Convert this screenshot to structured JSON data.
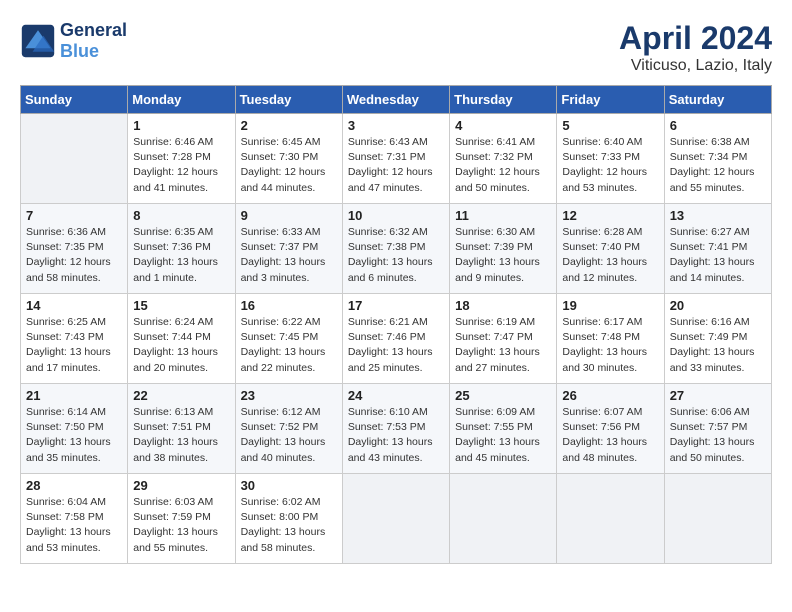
{
  "header": {
    "logo_line1": "General",
    "logo_line2": "Blue",
    "month_title": "April 2024",
    "location": "Viticuso, Lazio, Italy"
  },
  "weekdays": [
    "Sunday",
    "Monday",
    "Tuesday",
    "Wednesday",
    "Thursday",
    "Friday",
    "Saturday"
  ],
  "weeks": [
    [
      {
        "num": "",
        "empty": true
      },
      {
        "num": "1",
        "sunrise": "6:46 AM",
        "sunset": "7:28 PM",
        "daylight": "12 hours and 41 minutes."
      },
      {
        "num": "2",
        "sunrise": "6:45 AM",
        "sunset": "7:30 PM",
        "daylight": "12 hours and 44 minutes."
      },
      {
        "num": "3",
        "sunrise": "6:43 AM",
        "sunset": "7:31 PM",
        "daylight": "12 hours and 47 minutes."
      },
      {
        "num": "4",
        "sunrise": "6:41 AM",
        "sunset": "7:32 PM",
        "daylight": "12 hours and 50 minutes."
      },
      {
        "num": "5",
        "sunrise": "6:40 AM",
        "sunset": "7:33 PM",
        "daylight": "12 hours and 53 minutes."
      },
      {
        "num": "6",
        "sunrise": "6:38 AM",
        "sunset": "7:34 PM",
        "daylight": "12 hours and 55 minutes."
      }
    ],
    [
      {
        "num": "7",
        "sunrise": "6:36 AM",
        "sunset": "7:35 PM",
        "daylight": "12 hours and 58 minutes."
      },
      {
        "num": "8",
        "sunrise": "6:35 AM",
        "sunset": "7:36 PM",
        "daylight": "13 hours and 1 minute."
      },
      {
        "num": "9",
        "sunrise": "6:33 AM",
        "sunset": "7:37 PM",
        "daylight": "13 hours and 3 minutes."
      },
      {
        "num": "10",
        "sunrise": "6:32 AM",
        "sunset": "7:38 PM",
        "daylight": "13 hours and 6 minutes."
      },
      {
        "num": "11",
        "sunrise": "6:30 AM",
        "sunset": "7:39 PM",
        "daylight": "13 hours and 9 minutes."
      },
      {
        "num": "12",
        "sunrise": "6:28 AM",
        "sunset": "7:40 PM",
        "daylight": "13 hours and 12 minutes."
      },
      {
        "num": "13",
        "sunrise": "6:27 AM",
        "sunset": "7:41 PM",
        "daylight": "13 hours and 14 minutes."
      }
    ],
    [
      {
        "num": "14",
        "sunrise": "6:25 AM",
        "sunset": "7:43 PM",
        "daylight": "13 hours and 17 minutes."
      },
      {
        "num": "15",
        "sunrise": "6:24 AM",
        "sunset": "7:44 PM",
        "daylight": "13 hours and 20 minutes."
      },
      {
        "num": "16",
        "sunrise": "6:22 AM",
        "sunset": "7:45 PM",
        "daylight": "13 hours and 22 minutes."
      },
      {
        "num": "17",
        "sunrise": "6:21 AM",
        "sunset": "7:46 PM",
        "daylight": "13 hours and 25 minutes."
      },
      {
        "num": "18",
        "sunrise": "6:19 AM",
        "sunset": "7:47 PM",
        "daylight": "13 hours and 27 minutes."
      },
      {
        "num": "19",
        "sunrise": "6:17 AM",
        "sunset": "7:48 PM",
        "daylight": "13 hours and 30 minutes."
      },
      {
        "num": "20",
        "sunrise": "6:16 AM",
        "sunset": "7:49 PM",
        "daylight": "13 hours and 33 minutes."
      }
    ],
    [
      {
        "num": "21",
        "sunrise": "6:14 AM",
        "sunset": "7:50 PM",
        "daylight": "13 hours and 35 minutes."
      },
      {
        "num": "22",
        "sunrise": "6:13 AM",
        "sunset": "7:51 PM",
        "daylight": "13 hours and 38 minutes."
      },
      {
        "num": "23",
        "sunrise": "6:12 AM",
        "sunset": "7:52 PM",
        "daylight": "13 hours and 40 minutes."
      },
      {
        "num": "24",
        "sunrise": "6:10 AM",
        "sunset": "7:53 PM",
        "daylight": "13 hours and 43 minutes."
      },
      {
        "num": "25",
        "sunrise": "6:09 AM",
        "sunset": "7:55 PM",
        "daylight": "13 hours and 45 minutes."
      },
      {
        "num": "26",
        "sunrise": "6:07 AM",
        "sunset": "7:56 PM",
        "daylight": "13 hours and 48 minutes."
      },
      {
        "num": "27",
        "sunrise": "6:06 AM",
        "sunset": "7:57 PM",
        "daylight": "13 hours and 50 minutes."
      }
    ],
    [
      {
        "num": "28",
        "sunrise": "6:04 AM",
        "sunset": "7:58 PM",
        "daylight": "13 hours and 53 minutes."
      },
      {
        "num": "29",
        "sunrise": "6:03 AM",
        "sunset": "7:59 PM",
        "daylight": "13 hours and 55 minutes."
      },
      {
        "num": "30",
        "sunrise": "6:02 AM",
        "sunset": "8:00 PM",
        "daylight": "13 hours and 58 minutes."
      },
      {
        "num": "",
        "empty": true
      },
      {
        "num": "",
        "empty": true
      },
      {
        "num": "",
        "empty": true
      },
      {
        "num": "",
        "empty": true
      }
    ]
  ]
}
